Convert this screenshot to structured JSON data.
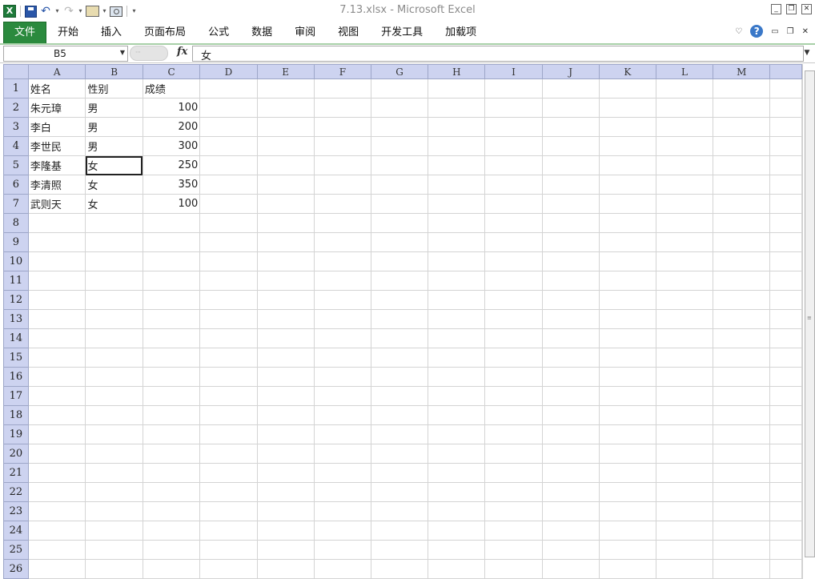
{
  "window": {
    "title": "7.13.xlsx  -  Microsoft Excel"
  },
  "qat": {
    "icons": [
      "excel-icon",
      "save-icon",
      "undo-icon",
      "redo-icon",
      "tools-icon",
      "camera-icon",
      "customize-dropdown-icon"
    ],
    "undo_glyph": "↶",
    "redo_glyph": "↷",
    "dd_glyph": "▾",
    "excel_glyph": "X"
  },
  "ribbon": {
    "tabs": [
      "文件",
      "开始",
      "插入",
      "页面布局",
      "公式",
      "数据",
      "审阅",
      "视图",
      "开发工具",
      "加载项"
    ],
    "help_glyph": "?",
    "collapse_glyph": "♡"
  },
  "formula_bar": {
    "name_box": "B5",
    "fx_label": "fx",
    "content": "女"
  },
  "sheet": {
    "columns": [
      "A",
      "B",
      "C",
      "D",
      "E",
      "F",
      "G",
      "H",
      "I",
      "J",
      "K",
      "L",
      "M"
    ],
    "rows": [
      {
        "num": "1",
        "cells": [
          "姓名",
          "性别",
          "成绩"
        ]
      },
      {
        "num": "2",
        "cells": [
          "朱元璋",
          "男",
          "100"
        ]
      },
      {
        "num": "3",
        "cells": [
          "李白",
          "男",
          "200"
        ]
      },
      {
        "num": "4",
        "cells": [
          "李世民",
          "男",
          "300"
        ]
      },
      {
        "num": "5",
        "cells": [
          "李隆基",
          "女",
          "250"
        ]
      },
      {
        "num": "6",
        "cells": [
          "李清照",
          "女",
          "350"
        ]
      },
      {
        "num": "7",
        "cells": [
          "武则天",
          "女",
          "100"
        ]
      },
      {
        "num": "8",
        "cells": []
      },
      {
        "num": "9",
        "cells": []
      },
      {
        "num": "10",
        "cells": []
      },
      {
        "num": "11",
        "cells": []
      },
      {
        "num": "12",
        "cells": []
      },
      {
        "num": "13",
        "cells": []
      },
      {
        "num": "14",
        "cells": []
      },
      {
        "num": "15",
        "cells": []
      },
      {
        "num": "16",
        "cells": []
      },
      {
        "num": "17",
        "cells": []
      },
      {
        "num": "18",
        "cells": []
      },
      {
        "num": "19",
        "cells": []
      },
      {
        "num": "20",
        "cells": []
      },
      {
        "num": "21",
        "cells": []
      },
      {
        "num": "22",
        "cells": []
      },
      {
        "num": "23",
        "cells": []
      },
      {
        "num": "24",
        "cells": []
      },
      {
        "num": "25",
        "cells": []
      },
      {
        "num": "26",
        "cells": []
      }
    ],
    "selected_cell": "B5"
  }
}
